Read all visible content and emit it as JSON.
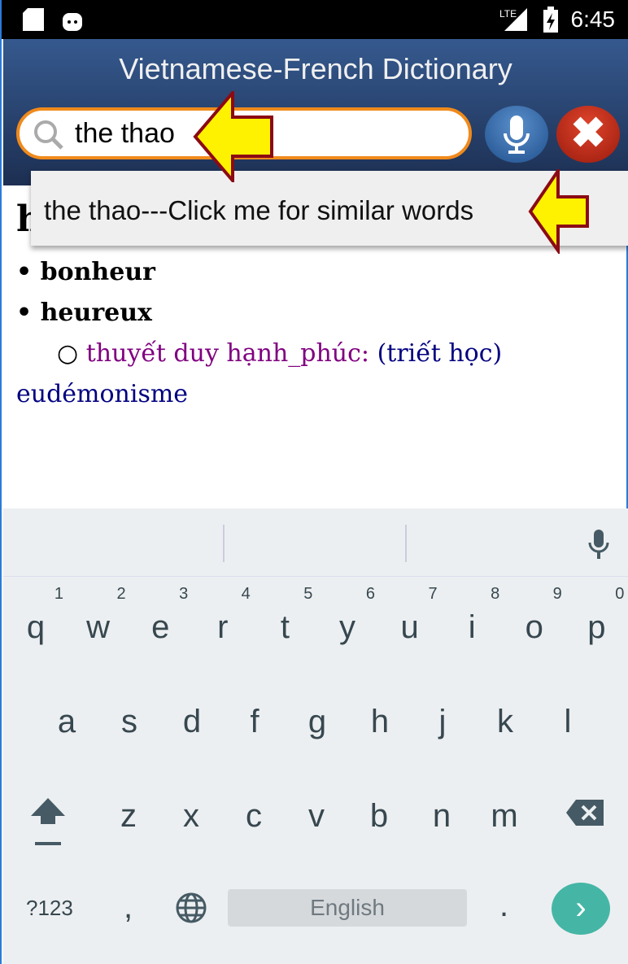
{
  "status": {
    "time": "6:45",
    "network": "LTE"
  },
  "header": {
    "title": "Vietnamese-French Dictionary"
  },
  "search": {
    "value": "the thao"
  },
  "dropdown": {
    "suggestion": "the thao---Click me for similar words"
  },
  "content": {
    "heading": "h",
    "items": [
      "bonheur",
      "heureux"
    ],
    "sub_term": "thuyết duy hạnh_phúc:",
    "sub_domain": "(triết học)",
    "sub_translation": "eudémonisme"
  },
  "keyboard": {
    "row1": [
      [
        "q",
        "1"
      ],
      [
        "w",
        "2"
      ],
      [
        "e",
        "3"
      ],
      [
        "r",
        "4"
      ],
      [
        "t",
        "5"
      ],
      [
        "y",
        "6"
      ],
      [
        "u",
        "7"
      ],
      [
        "i",
        "8"
      ],
      [
        "o",
        "9"
      ],
      [
        "p",
        "0"
      ]
    ],
    "row2": [
      "a",
      "s",
      "d",
      "f",
      "g",
      "h",
      "j",
      "k",
      "l"
    ],
    "row3": [
      "z",
      "x",
      "c",
      "v",
      "b",
      "n",
      "m"
    ],
    "symbols": "?123",
    "comma": ",",
    "space": "English",
    "period": "."
  },
  "colors": {
    "header": "#2a4672",
    "search_border": "#f08a1c",
    "arrow": "#fff200",
    "arrow_outline": "#8b0a14",
    "enter": "#45b6a6"
  }
}
